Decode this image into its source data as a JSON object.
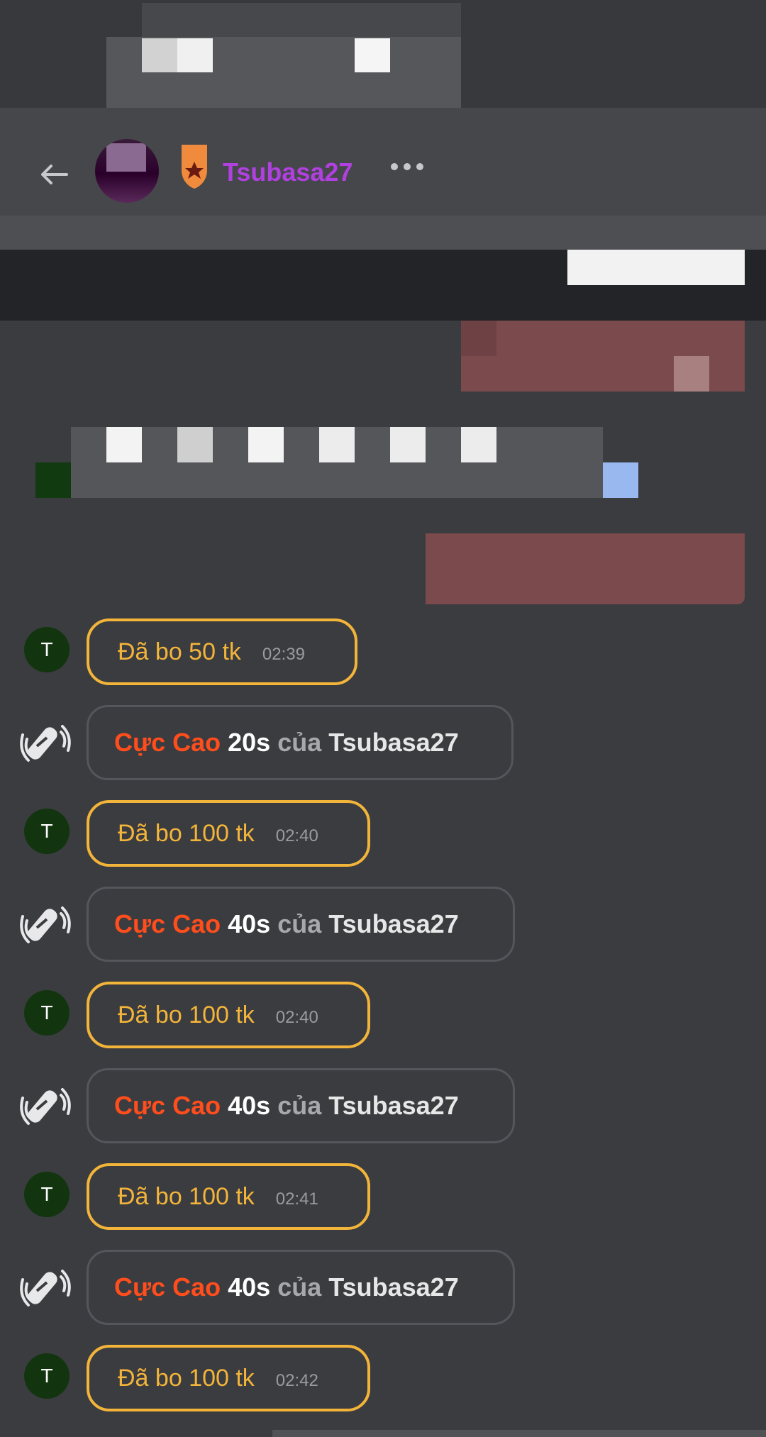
{
  "header": {
    "username": "Tsubasa27",
    "back_icon": "arrow-left-icon",
    "badge_icon": "star-badge-icon",
    "more_icon": "more-dots-icon"
  },
  "colors": {
    "background": "#3b3c40",
    "username": "#b140e0",
    "tip_accent": "#f3b43a",
    "event_name": "#ff4d1c"
  },
  "messages": [
    {
      "type": "tip",
      "avatar": "T",
      "text": "Đã bo 50 tk",
      "time": "02:39"
    },
    {
      "type": "event",
      "name": "Cực Cao",
      "duration": "20s",
      "of": "của",
      "user": "Tsubasa27"
    },
    {
      "type": "tip",
      "avatar": "T",
      "text": "Đã bo 100 tk",
      "time": "02:40"
    },
    {
      "type": "event",
      "name": "Cực Cao",
      "duration": "40s",
      "of": "của",
      "user": "Tsubasa27"
    },
    {
      "type": "tip",
      "avatar": "T",
      "text": "Đã bo 100 tk",
      "time": "02:40"
    },
    {
      "type": "event",
      "name": "Cực Cao",
      "duration": "40s",
      "of": "của",
      "user": "Tsubasa27"
    },
    {
      "type": "tip",
      "avatar": "T",
      "text": "Đã bo 100 tk",
      "time": "02:41"
    },
    {
      "type": "event",
      "name": "Cực Cao",
      "duration": "40s",
      "of": "của",
      "user": "Tsubasa27"
    },
    {
      "type": "tip",
      "avatar": "T",
      "text": "Đã bo 100 tk",
      "time": "02:42"
    }
  ]
}
